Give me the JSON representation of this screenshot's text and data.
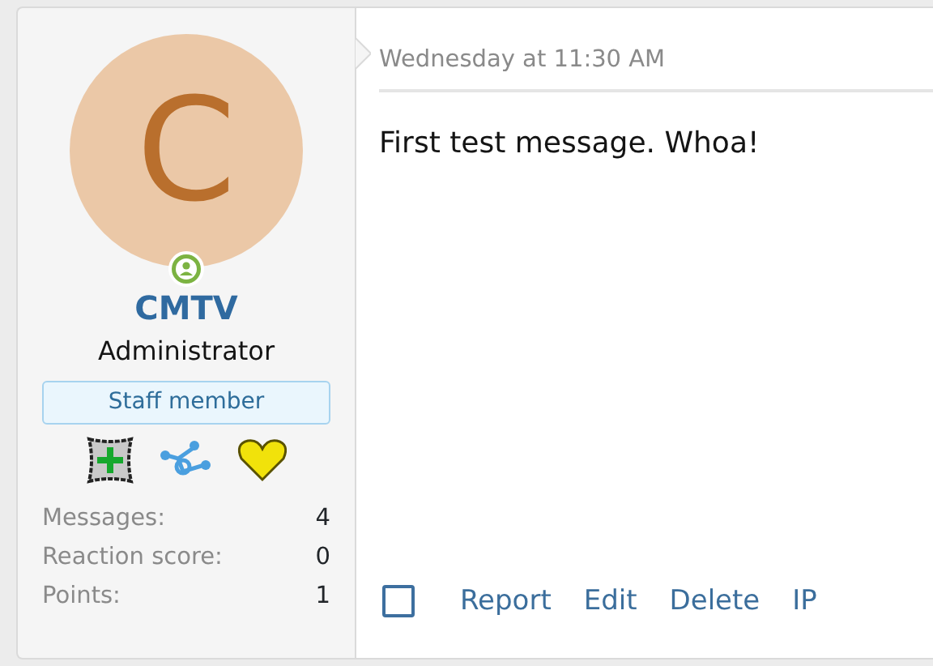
{
  "user": {
    "avatar_letter": "C",
    "online": true,
    "name": "CMTV",
    "title": "Administrator",
    "banner": "Staff member",
    "stats": [
      {
        "label": "Messages:",
        "value": "4"
      },
      {
        "label": "Reaction score:",
        "value": "0"
      },
      {
        "label": "Points:",
        "value": "1"
      }
    ]
  },
  "message": {
    "date": "Wednesday at 11:30 AM",
    "body": "First test message. Whoa!",
    "selected": false,
    "actions": [
      "Report",
      "Edit",
      "Delete",
      "IP"
    ]
  }
}
